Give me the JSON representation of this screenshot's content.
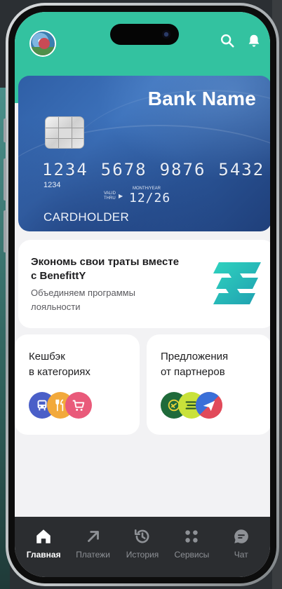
{
  "colors": {
    "header": "#33c2a0",
    "card": "#2f5fa6",
    "nav_bg": "#2b2d30",
    "nav_inactive": "#8e9196",
    "nav_active": "#ffffff",
    "accent_teal": "#2fbfb0"
  },
  "header": {
    "avatar_icon": "avatar-photo-icon",
    "search_icon": "search-icon",
    "bell_icon": "bell-icon"
  },
  "card": {
    "bank_name": "Bank Name",
    "number_groups": [
      "1234",
      "5678",
      "9876",
      "5432"
    ],
    "number_short": "1234",
    "valid_thru_line1": "VALID",
    "valid_thru_line2": "THRU",
    "month_year": "MONTH/YEAR",
    "expiry": "12/26",
    "holder": "CARDHOLDER"
  },
  "promo": {
    "title": "Экономь свои траты вместе с BenefittY",
    "subtitle": "Объединяем программы лояльности",
    "logo_icon": "benefitty-logo-icon"
  },
  "tiles": {
    "cashback": {
      "title_line1": "Кешбэк",
      "title_line2": "в категориях",
      "icons": [
        "bus-icon",
        "restaurant-icon",
        "shopping-cart-icon"
      ]
    },
    "partners": {
      "title_line1": "Предложения",
      "title_line2": "от партнеров",
      "icons": [
        "partner-logo-icon",
        "partner-logo-icon",
        "airplane-icon"
      ]
    }
  },
  "nav": {
    "items": [
      {
        "label": "Главная",
        "icon": "home-icon",
        "active": true
      },
      {
        "label": "Платежи",
        "icon": "arrow-up-right-icon",
        "active": false
      },
      {
        "label": "История",
        "icon": "history-icon",
        "active": false
      },
      {
        "label": "Сервисы",
        "icon": "grid-icon",
        "active": false
      },
      {
        "label": "Чат",
        "icon": "chat-icon",
        "active": false
      }
    ]
  }
}
